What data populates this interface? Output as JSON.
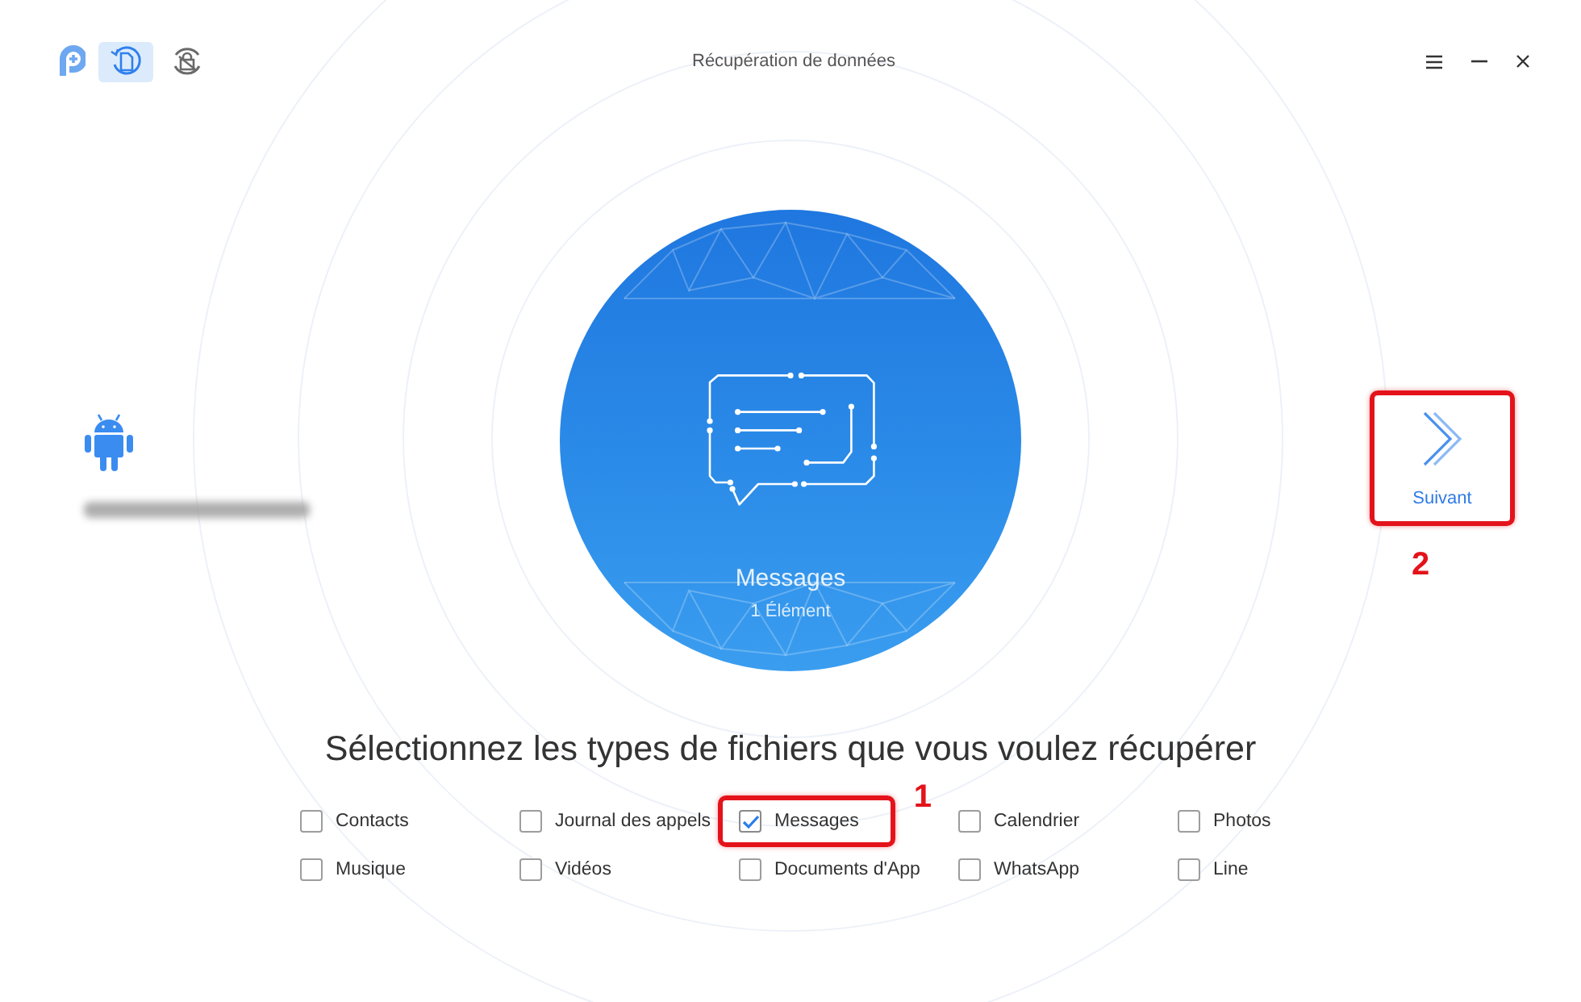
{
  "window": {
    "title": "Récupération de données"
  },
  "mode_tabs": [
    {
      "kind": "recover",
      "selected": true
    },
    {
      "kind": "unlock",
      "selected": false
    }
  ],
  "category_preview": {
    "title": "Messages",
    "count": "1 Élément"
  },
  "next_button": {
    "label": "Suivant",
    "annotation": "2"
  },
  "heading": "Sélectionnez les types de fichiers que vous voulez récupérer",
  "file_types": [
    {
      "label": "Contacts",
      "checked": false
    },
    {
      "label": "Journal des appels",
      "checked": false
    },
    {
      "label": "Messages",
      "checked": true,
      "annotation": "1"
    },
    {
      "label": "Calendrier",
      "checked": false
    },
    {
      "label": "Photos",
      "checked": false
    },
    {
      "label": "Musique",
      "checked": false
    },
    {
      "label": "Vidéos",
      "checked": false
    },
    {
      "label": "Documents d'App",
      "checked": false
    },
    {
      "label": "WhatsApp",
      "checked": false
    },
    {
      "label": "Line",
      "checked": false
    }
  ]
}
